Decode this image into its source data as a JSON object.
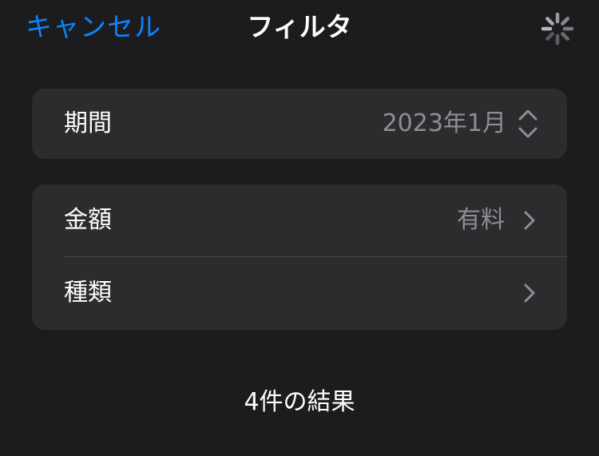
{
  "nav": {
    "cancel_label": "キャンセル",
    "title": "フィルタ",
    "spinner_icon": "activity-spinner-icon"
  },
  "period": {
    "label": "期間",
    "value": "2023年1月",
    "icon": "chevron-up-down-icon"
  },
  "filters": {
    "rows": [
      {
        "label": "金額",
        "value": "有料",
        "icon": "chevron-right-icon"
      },
      {
        "label": "種類",
        "value": "",
        "icon": "chevron-right-icon"
      }
    ]
  },
  "results": {
    "text": "4件の結果"
  },
  "colors": {
    "background": "#1c1c1e",
    "card": "#2c2c2e",
    "accent": "#0a84ff",
    "secondary_text": "#8e8e93",
    "separator": "#48484a"
  }
}
